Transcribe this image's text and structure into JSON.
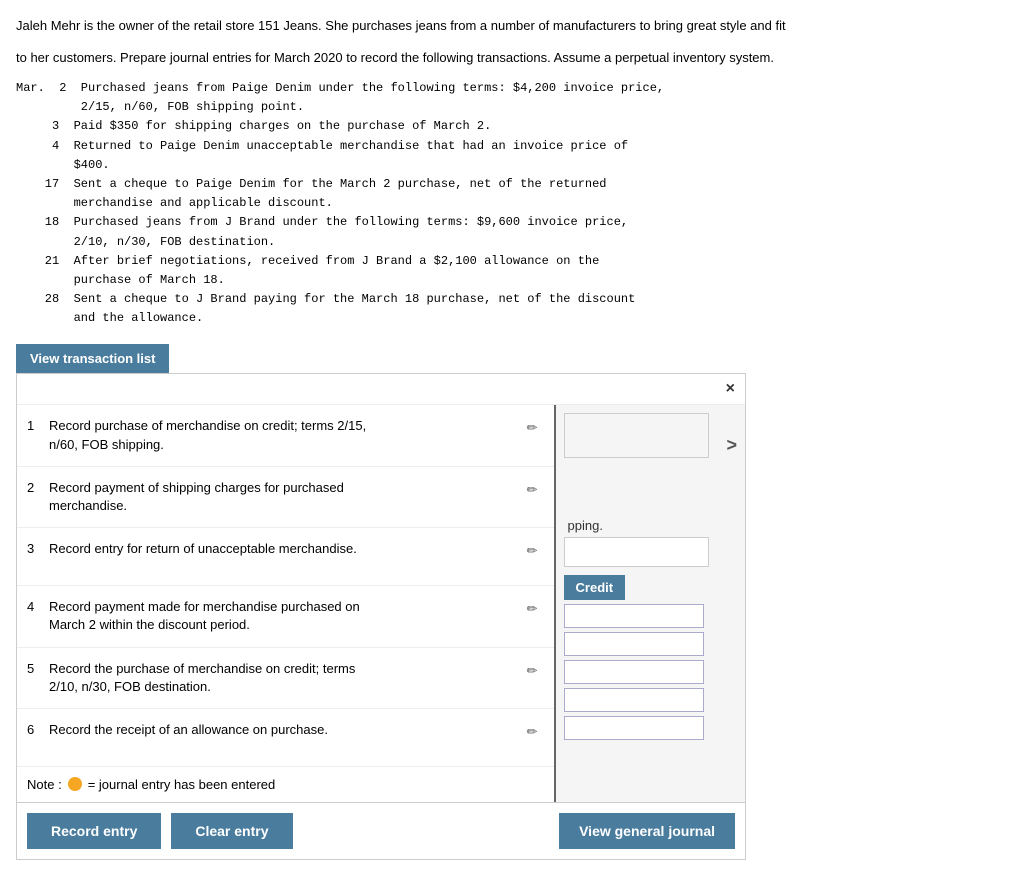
{
  "intro": {
    "line1": "Jaleh Mehr is the owner of the retail store 151 Jeans. She purchases jeans from a number of manufacturers to bring great style and fit",
    "line2": "to her customers. Prepare journal entries for March 2020 to record the following transactions. Assume a perpetual inventory system."
  },
  "transactions_raw": "Mar.  2  Purchased jeans from Paige Denim under the following terms: $4,200 invoice price,\n         2/15, n/60, FOB shipping point.\n     3  Paid $350 for shipping charges on the purchase of March 2.\n     4  Returned to Paige Denim unacceptable merchandise that had an invoice price of\n        $400.\n    17  Sent a cheque to Paige Denim for the March 2 purchase, net of the returned\n        merchandise and applicable discount.\n    18  Purchased jeans from J Brand under the following terms: $9,600 invoice price,\n        2/10, n/30, FOB destination.\n    21  After brief negotiations, received from J Brand a $2,100 allowance on the\n        purchase of March 18.\n    28  Sent a cheque to J Brand paying for the March 18 purchase, net of the discount\n        and the allowance.",
  "view_transaction_btn": "View transaction list",
  "close_btn": "×",
  "items": [
    {
      "num": "1",
      "desc": "Record purchase of merchandise on credit; terms 2/15, n/60, FOB shipping.",
      "has_dot": false
    },
    {
      "num": "2",
      "desc": "Record payment of shipping charges for purchased merchandise.",
      "has_dot": false
    },
    {
      "num": "3",
      "desc": "Record entry for return of unacceptable merchandise.",
      "has_dot": false
    },
    {
      "num": "4",
      "desc": "Record payment made for merchandise purchased on March 2 within the discount period.",
      "has_dot": false
    },
    {
      "num": "5",
      "desc": "Record the purchase of merchandise on credit; terms 2/10, n/30, FOB destination.",
      "has_dot": false
    },
    {
      "num": "6",
      "desc": "Record the receipt of an allowance on purchase.",
      "has_dot": false
    }
  ],
  "note_text": "= journal entry has been entered",
  "chevron": ">",
  "partial_label": "pping.",
  "credit_btn": "Credit",
  "inputs": [
    "",
    "",
    "",
    "",
    ""
  ],
  "bottom_btns": {
    "record": "Record entry",
    "clear": "Clear entry",
    "view_journal": "View general journal"
  }
}
